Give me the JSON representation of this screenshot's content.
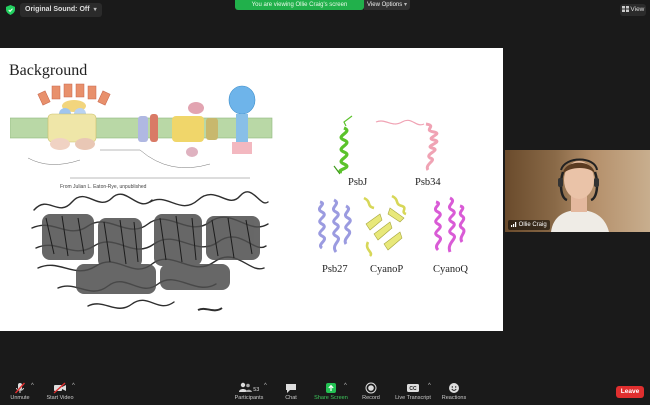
{
  "top": {
    "original_sound": "Original Sound: Off",
    "viewing_banner": "You are viewing Ollie Craig's screen",
    "view_options": "View Options",
    "view_button": "View"
  },
  "slide": {
    "title": "Background",
    "caption": "From Julian L. Eaton-Rye, unpublished",
    "protein_labels": [
      "PsbJ",
      "Psb34",
      "Psb27",
      "CyanoP",
      "CyanoQ"
    ],
    "colors": {
      "psbj": "#5bc32b",
      "psb34": "#f0a3b4",
      "psb27": "#9b9be0",
      "cyanop": "#e8e87a",
      "cyanoq": "#d95bd6"
    }
  },
  "video": {
    "participant_name": "Ollie Craig"
  },
  "toolbar": {
    "unmute": "Unmute",
    "start_video": "Start Video",
    "participants": "Participants",
    "participants_count": "53",
    "chat": "Chat",
    "share_screen": "Share Screen",
    "record": "Record",
    "live_transcript": "Live Transcript",
    "reactions": "Reactions",
    "leave": "Leave",
    "icons": [
      "mic-muted-icon",
      "video-off-icon",
      "participants-icon",
      "chat-icon",
      "share-screen-icon",
      "record-icon",
      "cc-icon",
      "reactions-icon"
    ]
  }
}
